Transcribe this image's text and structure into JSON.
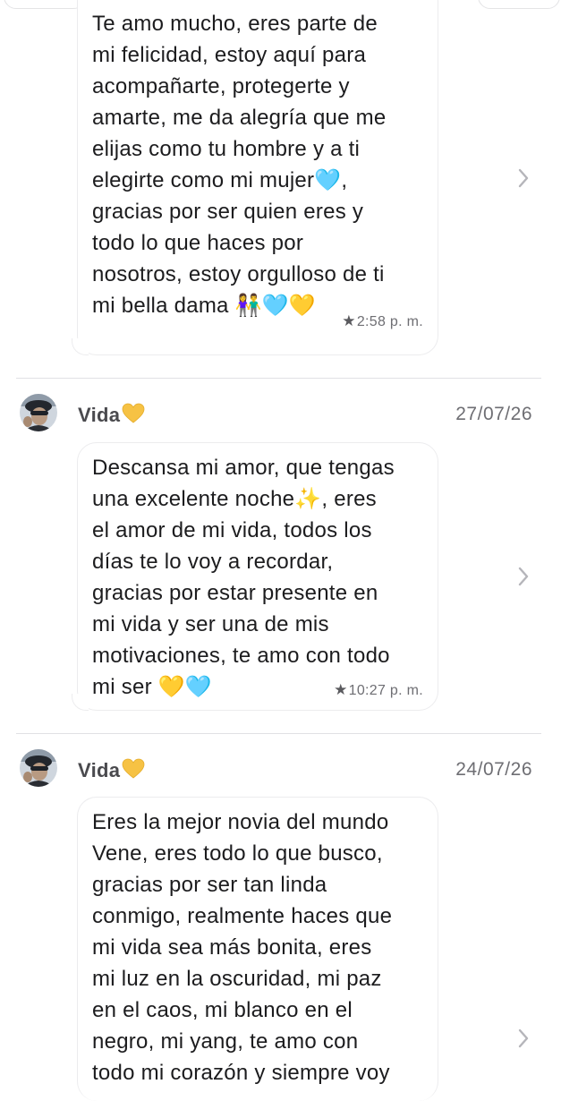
{
  "messages": [
    {
      "text": "Te amo mucho, eres parte de\nmi felicidad, estoy aquí para\nacompañarte, protegerte y\namarte, me da alegría que me\nelijas como tu hombre y a ti\nelegirte como mi mujer🩵,\ngracias por ser quien eres y\ntodo lo que haces por\nnosotros, estoy orgulloso de ti\nmi bella dama 👫🩵💛",
      "time": "2:58 p. m.",
      "starred": true
    },
    {
      "sender": "Vida",
      "sender_emoji": "yellow-heart",
      "date": "27/07/26",
      "text": "Descansa mi amor, que tengas\nuna excelente noche✨, eres\nel amor de mi vida, todos los\ndías te lo voy a recordar,\ngracias por estar presente en\nmi vida y ser una de mis\nmotivaciones, te amo con todo\nmi ser 💛🩵",
      "time": "10:27 p. m.",
      "starred": true
    },
    {
      "sender": "Vida",
      "sender_emoji": "yellow-heart",
      "date": "24/07/26",
      "text": "Eres la mejor novia del mundo\nVene, eres todo lo que busco,\ngracias por ser tan linda\nconmigo, realmente haces que\nmi vida sea más bonita, eres\nmi luz en la oscuridad, mi paz\nen el caos, mi blanco en el\nnegro, mi yang, te amo con\ntodo mi corazón y siempre voy"
    }
  ],
  "icons": {
    "star": "star-icon",
    "chevron": "chevron-right-icon",
    "avatar": "avatar"
  },
  "colors": {
    "text": "#1c1c1e",
    "meta": "#6e6e73",
    "divider": "#e1e1e4",
    "chevron": "#b5b5ba",
    "yellow_heart": "#f6c244"
  }
}
